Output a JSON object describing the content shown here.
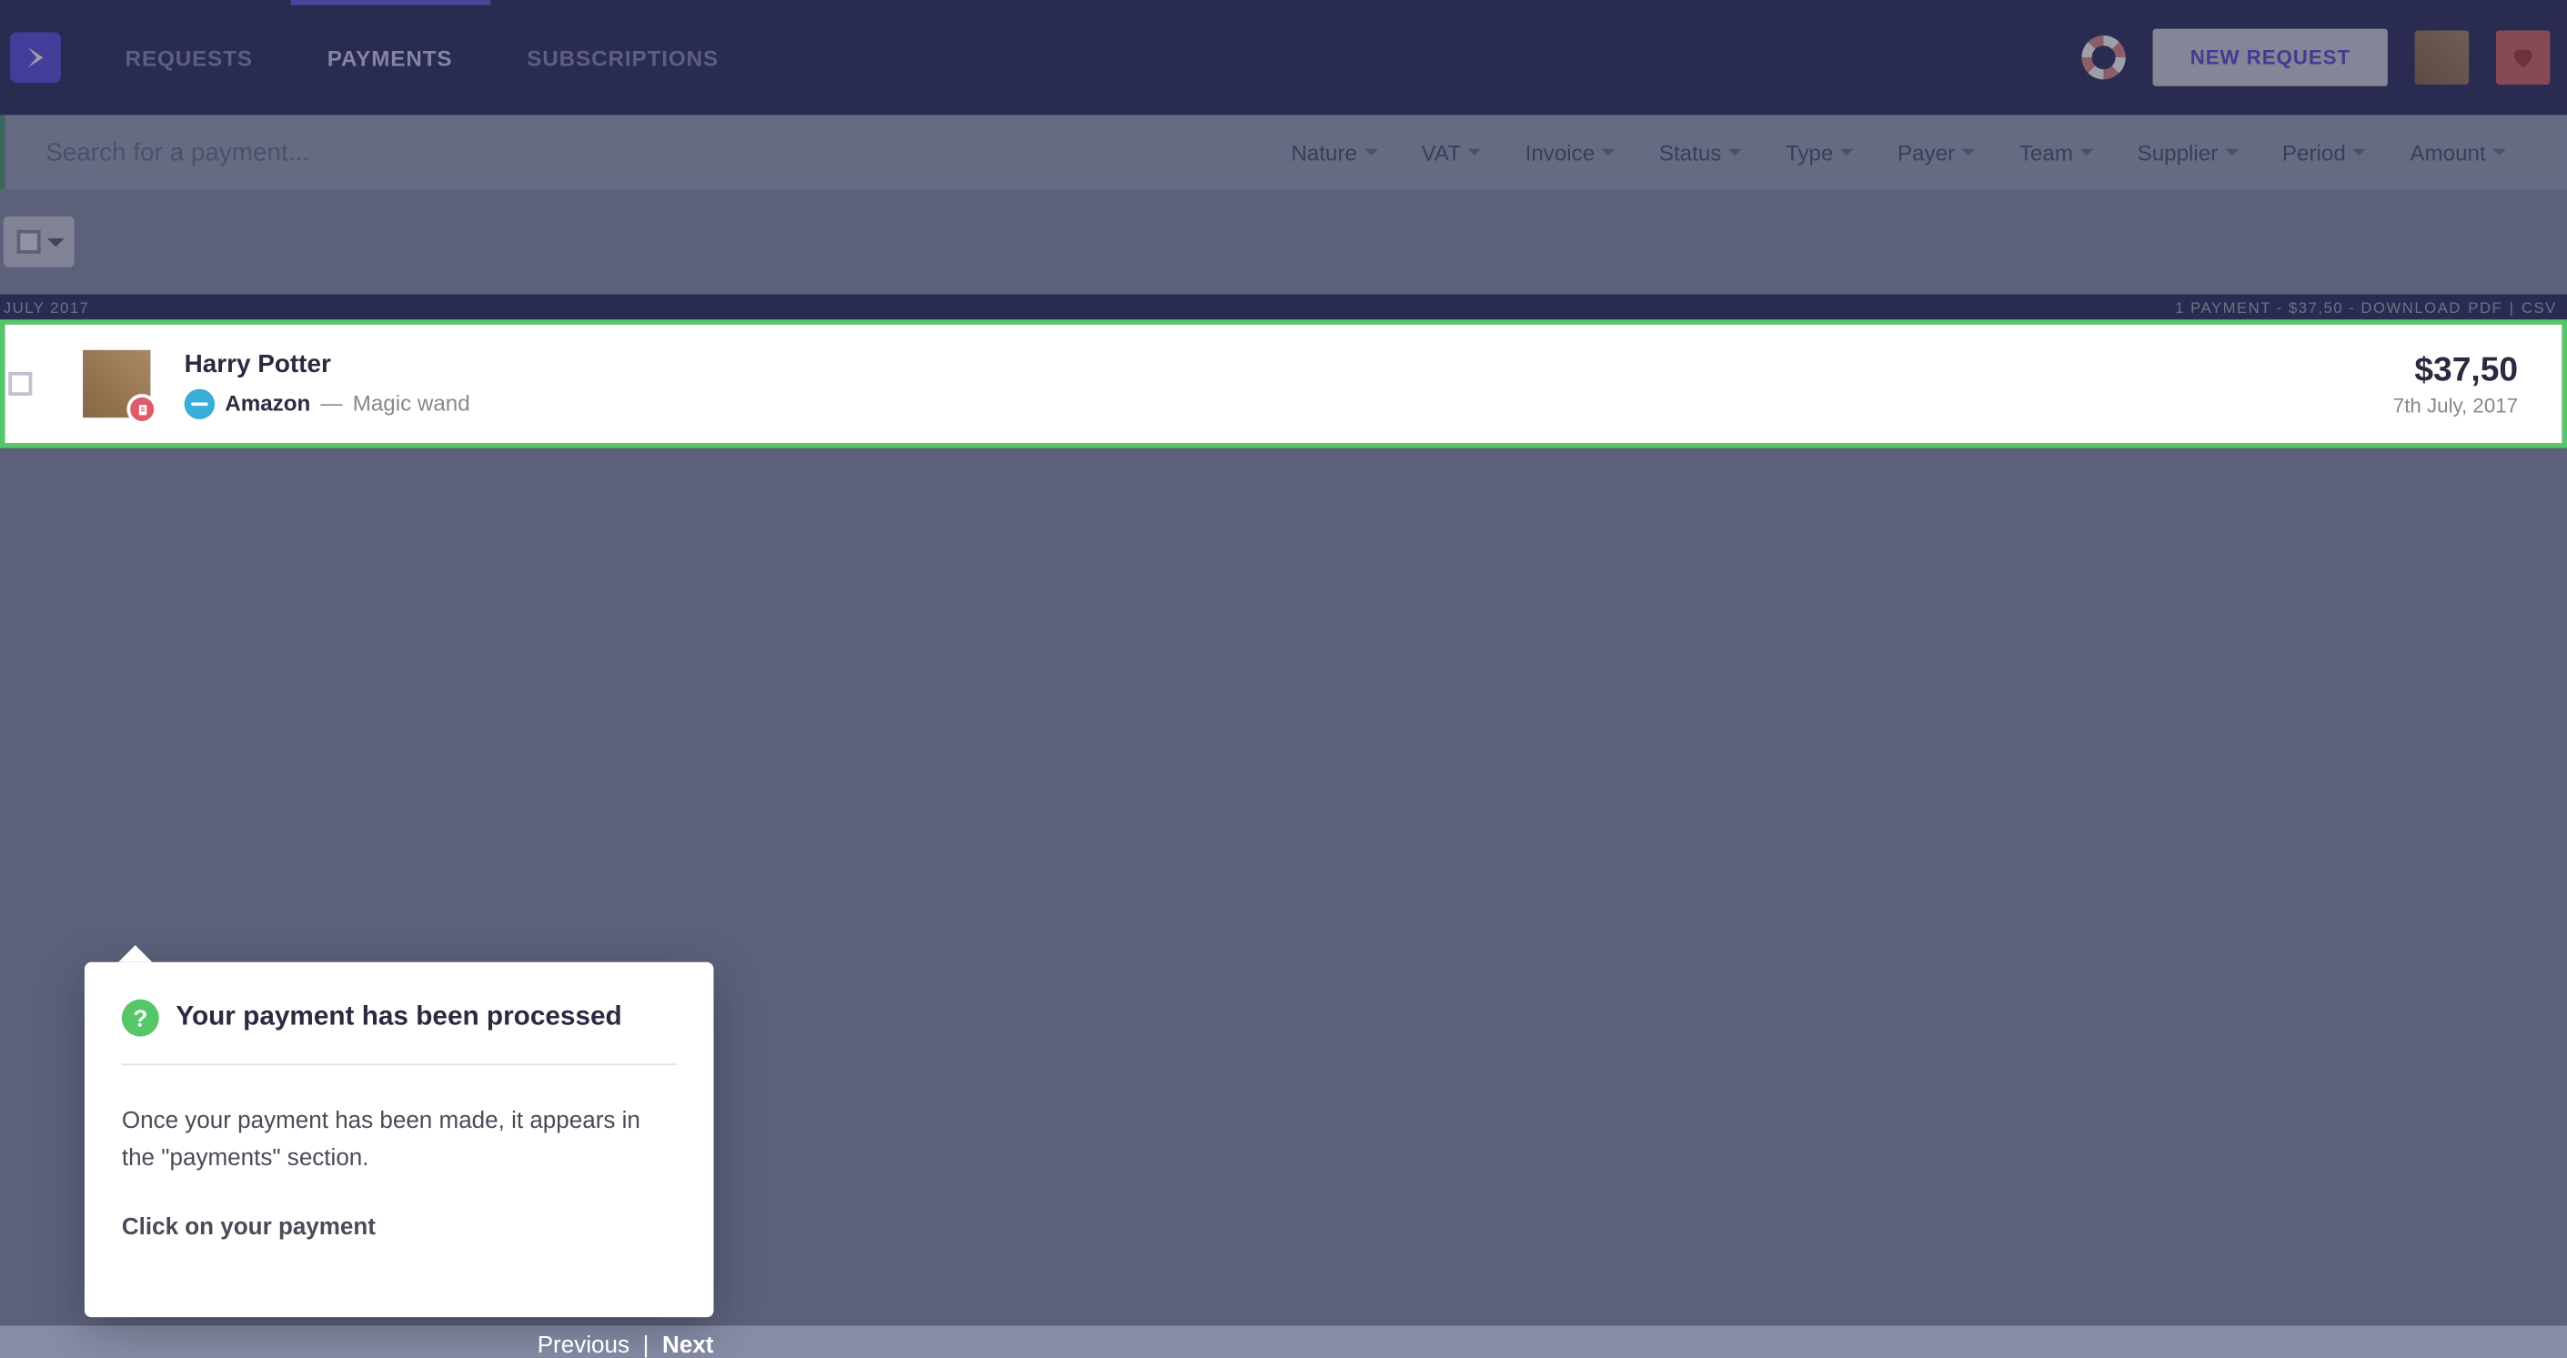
{
  "nav": {
    "tabs": [
      {
        "label": "REQUESTS",
        "active": false
      },
      {
        "label": "PAYMENTS",
        "active": true
      },
      {
        "label": "SUBSCRIPTIONS",
        "active": false
      }
    ],
    "new_request_label": "NEW REQUEST"
  },
  "filter": {
    "search_placeholder": "Search for a payment...",
    "dropdowns": [
      "Nature",
      "VAT",
      "Invoice",
      "Status",
      "Type",
      "Payer",
      "Team",
      "Supplier",
      "Period",
      "Amount"
    ]
  },
  "month_header": {
    "label": "JULY 2017",
    "summary": "1 PAYMENT - $37,50 - DOWNLOAD",
    "pdf": "PDF",
    "csv": "CSV"
  },
  "payment": {
    "name": "Harry Potter",
    "supplier": "Amazon",
    "separator": "—",
    "description": "Magic wand",
    "amount": "$37,50",
    "date": "7th July, 2017"
  },
  "tooltip": {
    "title": "Your payment has been processed",
    "body": "Once your payment has been made, it appears in the \"payments\" section.",
    "cta": "Click on your payment",
    "prev": "Previous",
    "next": "Next"
  }
}
